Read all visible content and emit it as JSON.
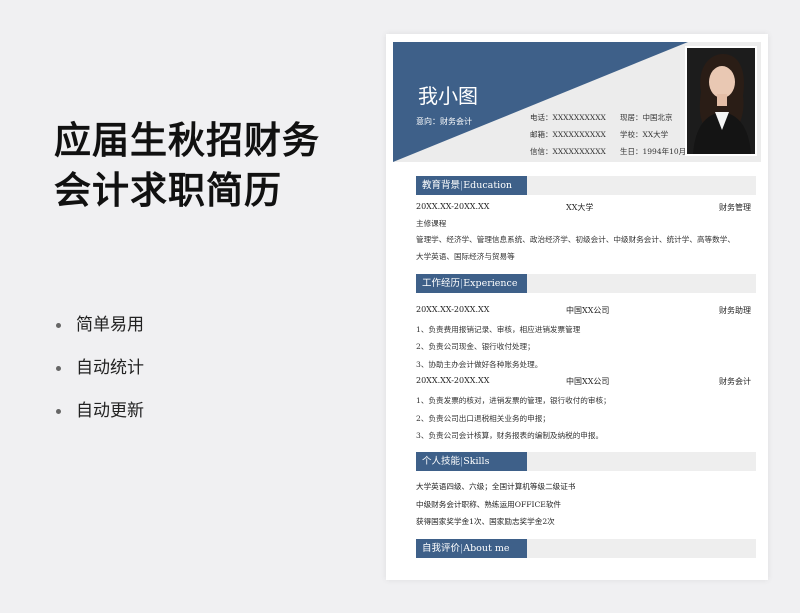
{
  "title": {
    "line1": "应届生秋招财务",
    "line2": "会计求职简历"
  },
  "features": [
    "简单易用",
    "自动统计",
    "自动更新"
  ],
  "resume": {
    "name": "我小图",
    "intent": "意向：财务会计",
    "contact": {
      "phone": "电话：XXXXXXXXXX",
      "email": "邮箱：XXXXXXXXXX",
      "wechat": "信信：XXXXXXXXXX",
      "location": "现居：中国北京",
      "school": "学校：XX大学",
      "birth": "生日：1994年10月"
    },
    "education": {
      "title": "教育背景",
      "title_en": "Education",
      "period": "20XX.XX-20XX.XX",
      "school": "XX大学",
      "major": "财务管理",
      "courses_label": "主修课程",
      "courses_line1": "管理学、经济学、管理信息系统、政治经济学、初级会计、中级财务会计、统计学、高等数学、",
      "courses_line2": "大学英语、国际经济与贸易等"
    },
    "experience": {
      "title": "工作经历",
      "title_en": "Experience",
      "jobs": [
        {
          "period": "20XX.XX-20XX.XX",
          "company": "中国XX公司",
          "role": "财务助理",
          "duties": [
            "1、负责费用报销记录、审核，相应进销发票管理",
            "2、负责公司现金、银行收付处理；",
            "3、协助主办会计做好各种账务处理。"
          ]
        },
        {
          "period": "20XX.XX-20XX.XX",
          "company": "中国XX公司",
          "role": "财务会计",
          "duties": [
            "1、负责发票的核对，进销发票的管理，银行收付的审核；",
            "2、负责公司出口退税相关业务的申报；",
            "3、负责公司会计核算，财务报表的编制及纳税的申报。"
          ]
        }
      ]
    },
    "skills": {
      "title": "个人技能",
      "title_en": "Skills",
      "items": [
        "大学英语四级、六级；全国计算机等级二级证书",
        "中级财务会计职称、熟练运用OFFICE软件",
        "获得国家奖学金1次、国家励志奖学金2次"
      ]
    },
    "about": {
      "title": "自我评价",
      "title_en": "About me"
    }
  },
  "colors": {
    "accent": "#3e6089",
    "section_bg": "#eeeeee",
    "page_bg": "#f0f0f2"
  }
}
